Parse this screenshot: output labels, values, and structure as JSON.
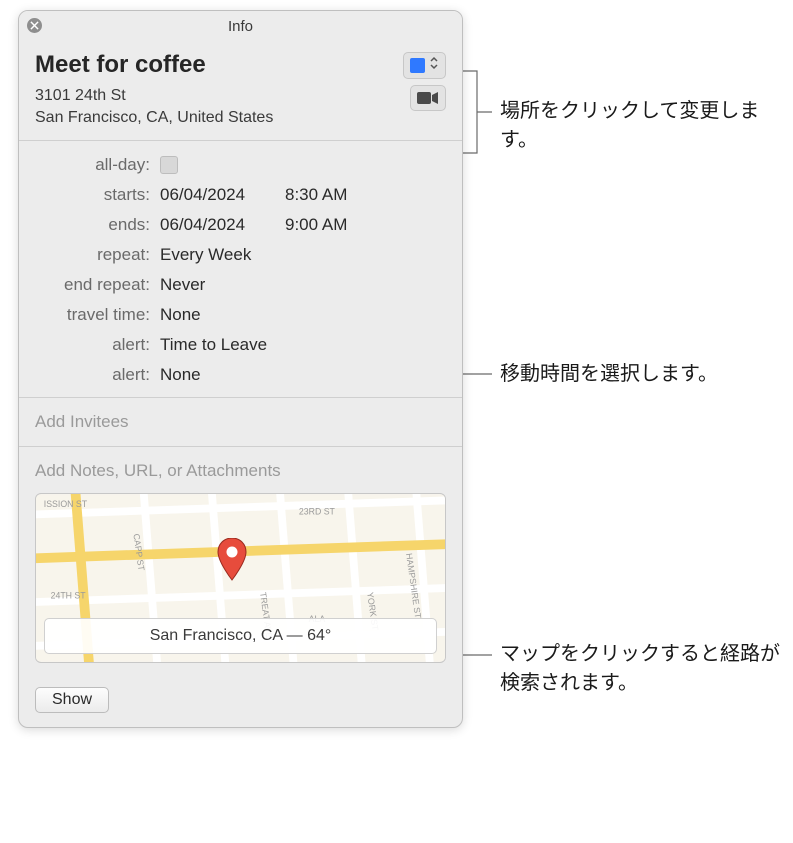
{
  "window": {
    "title": "Info"
  },
  "event": {
    "title": "Meet for coffee",
    "location_line1": "3101 24th St",
    "location_line2": "San Francisco, CA, United States"
  },
  "labels": {
    "all_day": "all-day:",
    "starts": "starts:",
    "ends": "ends:",
    "repeat": "repeat:",
    "end_repeat": "end repeat:",
    "travel_time": "travel time:",
    "alert1": "alert:",
    "alert2": "alert:"
  },
  "values": {
    "start_date": "06/04/2024",
    "start_time": "8:30 AM",
    "end_date": "06/04/2024",
    "end_time": "9:00 AM",
    "repeat": "Every Week",
    "end_repeat": "Never",
    "travel_time": "None",
    "alert1": "Time to Leave",
    "alert2": "None"
  },
  "sections": {
    "invitees": "Add Invitees",
    "notes": "Add Notes, URL, or Attachments"
  },
  "map": {
    "caption": "San Francisco, CA — 64°",
    "streets": {
      "s1": "ISSION ST",
      "s2": "23RD ST",
      "s3": "24TH ST",
      "s4": "CAPP ST",
      "s5": "TREAT AVE",
      "s6": "HAMPSHIRE ST",
      "s7": "YORK ST",
      "s8": "ALA"
    }
  },
  "buttons": {
    "show": "Show"
  },
  "annotations": {
    "a1": "場所をクリックして変更します。",
    "a2": "移動時間を選択します。",
    "a3": "マップをクリックすると経路が検索されます。"
  }
}
